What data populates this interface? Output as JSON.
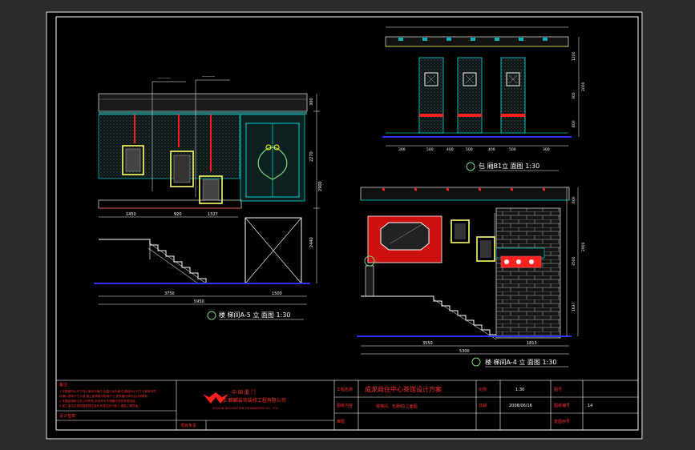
{
  "views": {
    "a5": {
      "caption": "楼 梯间A-5 立 面图 1:30",
      "dim_total": "5950",
      "dim_left": "3750",
      "dim_right": "1500",
      "dim_a": "1450",
      "dim_b": "920",
      "dim_c": "1327",
      "heights": [
        "300",
        "2270",
        "2900",
        "2440"
      ]
    },
    "b1": {
      "caption": "包 厢B1立 面图 1:30",
      "dims": [
        "300",
        "500",
        "400",
        "500",
        "400",
        "500",
        "300"
      ],
      "heights": [
        "1200",
        "2000",
        "300",
        "600"
      ]
    },
    "a4": {
      "caption": "楼 梯间A-4 立 面图 1:30",
      "dim_total": "5300",
      "dim_left": "3550",
      "dim_right": "1813",
      "heights": [
        "600",
        "2900",
        "3500",
        "1637"
      ]
    }
  },
  "title_block": {
    "notes_label": "备注:",
    "notes": [
      "1.本图纸所示尺寸均以毫米为单位,标高以米为单位,图纸所示尺寸与现场不符",
      "时请以现场尺寸为准,施工前请核对现场尺寸,如有疑问请与设计师联系。",
      "2.本图纸版权归本公司所有,未经许可不得翻印或作其他用途。",
      "3.施工单位应按照国家规范及有关规定进行施工,确保工程质量。"
    ],
    "designer_label": "设计签章",
    "project_owner_label": "项目负责",
    "company_cn_line1": "中 国    厦 门",
    "company_cn_line2": "玉 麒麟装饰装修工程有限公司",
    "company_en": "YUQILIN DECORATION ENGINEERING CO., LTD.",
    "project_name_label": "工程名称",
    "project_name": "成龙商住中心茶馆设计方案",
    "drawing_content_label": "图纸内容",
    "drawing_content": "楼梯间、包厢B1立面图",
    "review_label": "审图",
    "scale_label": "比例",
    "scale": "1:30",
    "drawing_no_label": "图号",
    "date_label": "日期",
    "date": "2008/06/16",
    "sheet_no_label": "图纸编号",
    "sheet_no": "14",
    "check_label": "复图序号"
  }
}
